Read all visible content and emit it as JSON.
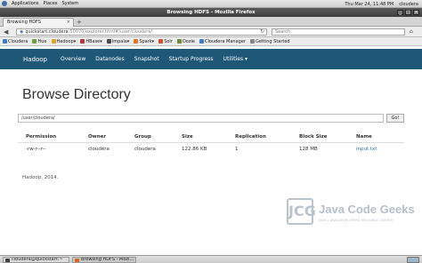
{
  "top_panel": {
    "menus": [
      "Applications",
      "Places",
      "System"
    ],
    "clock": "Thu Mar 24, 11:48 PM",
    "user": "cloudera"
  },
  "window": {
    "title": "Browsing HDFS - Mozilla Firefox"
  },
  "tab": {
    "label": "Browsing HDFS",
    "close": "×",
    "new_tab": "+"
  },
  "nav": {
    "url_host": "quickstart.cloudera",
    "url_path": ":50070/explorer.html#/user/cloudera/",
    "search_placeholder": "Search",
    "back": "◀",
    "reload": "↻",
    "home": "⌂"
  },
  "bookmarks": [
    {
      "label": "Cloudera",
      "color": "#3c7dc4"
    },
    {
      "label": "Hue",
      "color": "#6da13f"
    },
    {
      "label": "Hadoop▾",
      "color": "#e0a526"
    },
    {
      "label": "HBase▾",
      "color": "#b23b3b"
    },
    {
      "label": "Impala▾",
      "color": "#4a4a4a"
    },
    {
      "label": "Spark▾",
      "color": "#e2742a"
    },
    {
      "label": "Solr",
      "color": "#d74f2b"
    },
    {
      "label": "Oozie",
      "color": "#6e8a3a"
    },
    {
      "label": "Cloudera Manager",
      "color": "#3c7dc4"
    },
    {
      "label": "Getting Started",
      "color": "#888888"
    }
  ],
  "hadoop_nav": {
    "brand": "Hadoop",
    "items": [
      "Overview",
      "Datanodes",
      "Snapshot",
      "Startup Progress",
      "Utilities ▾"
    ]
  },
  "page": {
    "title": "Browse Directory",
    "path_value": "/user/cloudera/",
    "go_label": "Go!",
    "footer": "Hadoop, 2014."
  },
  "table": {
    "headers": [
      "Permission",
      "Owner",
      "Group",
      "Size",
      "Replication",
      "Block Size",
      "Name"
    ],
    "rows": [
      {
        "permission": "-rw-r--r--",
        "owner": "cloudera",
        "group": "cloudera",
        "size": "122.86 KB",
        "replication": "1",
        "block_size": "128 MB",
        "name": "input.txt"
      }
    ]
  },
  "watermark": {
    "logo_text": "JCG",
    "title": "Java Code Geeks",
    "subtitle": "JAVA 2 JAVA DEVELOPERS RESOURCE CENTER"
  },
  "taskbar": {
    "items": [
      "cloudera@quickstart:~",
      "Browsing HDFS - Mozi..."
    ]
  }
}
